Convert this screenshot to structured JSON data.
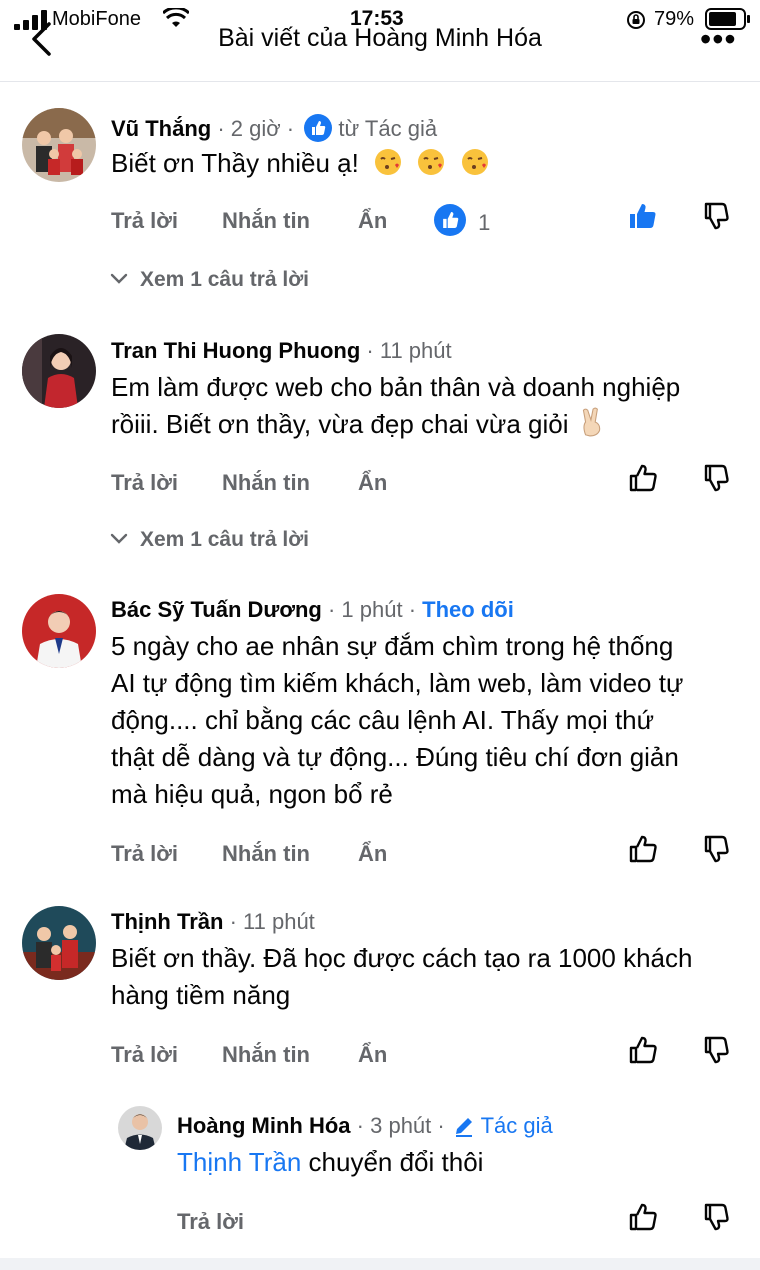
{
  "status_bar": {
    "carrier": "MobiFone",
    "time": "17:53",
    "battery": "79%"
  },
  "header": {
    "title": "Bài viết của Hoàng Minh Hóa"
  },
  "actions": {
    "reply": "Trả lời",
    "message": "Nhắn tin",
    "hide": "Ẩn"
  },
  "comments": [
    {
      "name": "Vũ Thắng",
      "time": "· 2 giờ ·",
      "badge": "từ Tác giả",
      "text": "Biết ơn Thầy nhiều ạ!",
      "like_count": "1",
      "view_replies": "Xem 1 câu trả lời"
    },
    {
      "name": "Tran Thi Huong Phuong",
      "time": "· 11 phút",
      "text_line1": "Em làm được web cho bản thân và doanh nghiệp",
      "text_line2": "rồiii. Biết ơn thầy, vừa đẹp chai vừa giỏi",
      "view_replies": "Xem 1 câu trả lời"
    },
    {
      "name": "Bác Sỹ Tuấn Dương",
      "time": "· 1 phút ·",
      "follow": "Theo dõi",
      "lines": [
        "5 ngày cho ae nhân sự đắm chìm trong hệ thống",
        "AI tự động tìm kiếm khách, làm web, làm video tự",
        "động.... chỉ bằng các câu lệnh AI. Thấy mọi thứ",
        "thật dễ dàng và tự động... Đúng tiêu chí đơn giản",
        "mà hiệu quả, ngon bổ rẻ"
      ]
    },
    {
      "name": "Thịnh Trần",
      "time": "· 11 phút",
      "lines": [
        "Biết ơn thầy. Đã học được cách tạo ra 1000 khách",
        "hàng tiềm năng"
      ]
    }
  ],
  "reply": {
    "name": "Hoàng Minh Hóa",
    "time": "· 3 phút ·",
    "author_badge": "Tác giả",
    "mention": "Thịnh Trần",
    "text": " chuyển đổi thôi"
  },
  "colors": {
    "accent": "#1877f2",
    "secondary_text": "#65676b",
    "divider": "#e4e6eb"
  }
}
